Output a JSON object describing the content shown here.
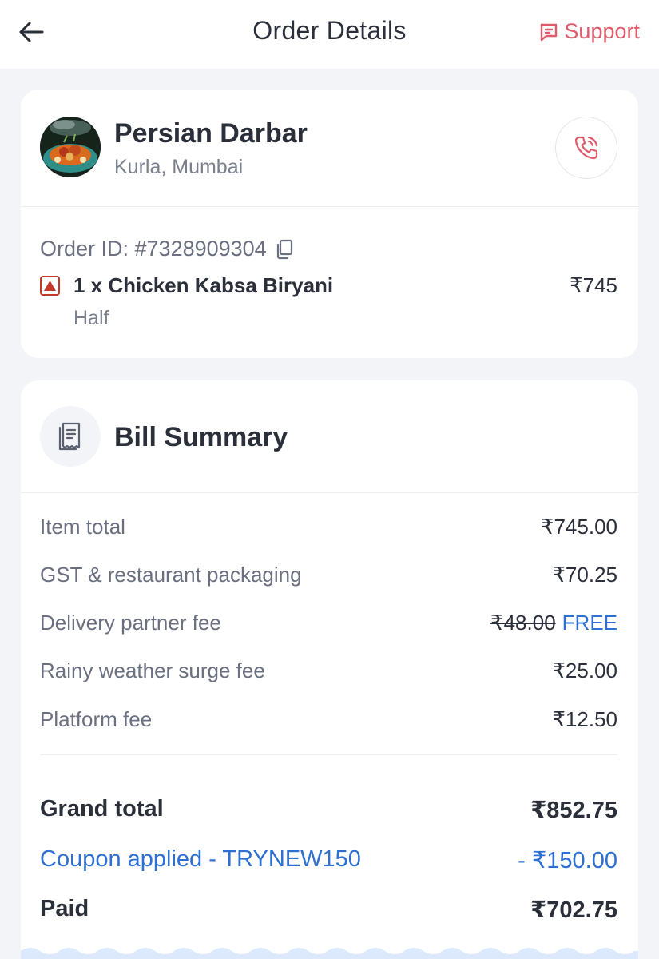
{
  "header": {
    "title": "Order Details",
    "support_label": "Support"
  },
  "restaurant": {
    "name": "Persian Darbar",
    "location": "Kurla, Mumbai"
  },
  "order": {
    "id_label": "Order ID: #7328909304",
    "items": [
      {
        "name": "1 x Chicken Kabsa Biryani",
        "variant": "Half",
        "price": "₹745",
        "type": "non-veg"
      }
    ]
  },
  "bill": {
    "title": "Bill Summary",
    "rows": [
      {
        "label": "Item total",
        "value": "₹745.00"
      },
      {
        "label": "GST & restaurant packaging",
        "value": "₹70.25"
      },
      {
        "label": "Delivery partner fee",
        "original": "₹48.00",
        "value": "FREE"
      },
      {
        "label": "Rainy weather surge fee",
        "value": "₹25.00"
      },
      {
        "label": "Platform fee",
        "value": "₹12.50"
      }
    ],
    "grand_total": {
      "label": "Grand total",
      "value": "₹852.75"
    },
    "coupon": {
      "label": "Coupon applied - TRYNEW150",
      "value": "- ₹150.00"
    },
    "paid": {
      "label": "Paid",
      "value": "₹702.75"
    }
  },
  "colors": {
    "accent_red": "#e05a6b",
    "accent_blue": "#2d6fd2",
    "nonveg": "#c0392b"
  },
  "icons": [
    "back-arrow-icon",
    "support-chat-icon",
    "phone-call-icon",
    "copy-icon",
    "non-veg-icon",
    "receipt-icon"
  ]
}
